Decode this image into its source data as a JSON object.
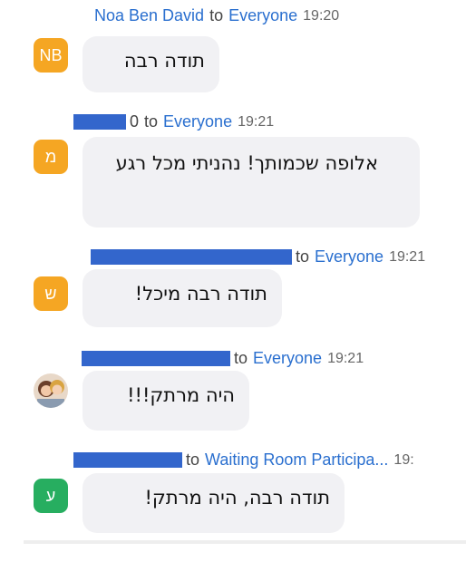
{
  "messages": [
    {
      "sender": "Noa Ben David",
      "to_word": "to",
      "recipient": "Everyone",
      "time": "19:20",
      "avatar": "NB",
      "avatar_color": "#f5a623",
      "text": "תודה רבה"
    },
    {
      "sender_tail": "0",
      "to_word": "to",
      "recipient": "Everyone",
      "time": "19:21",
      "avatar": "מ",
      "avatar_color": "#f5a623",
      "text": "אלופה שכמותך! נהניתי מכל רגע"
    },
    {
      "to_word": "to",
      "recipient": "Everyone",
      "time": "19:21",
      "avatar": "ש",
      "avatar_color": "#f5a623",
      "text": "תודה רבה מיכל!"
    },
    {
      "to_word": "to",
      "recipient": "Everyone",
      "time": "19:21",
      "avatar": "profile-photo",
      "text": "היה מרתק!!!"
    },
    {
      "to_word": "to",
      "recipient": "Waiting Room Participa...",
      "time": "19:",
      "avatar": "ע",
      "avatar_color": "#27ae60",
      "text": "תודה רבה, היה מרתק!"
    }
  ],
  "colors": {
    "bubble": "#f1f1f4",
    "link": "#2a6fcf",
    "redaction": "#3366cc"
  }
}
